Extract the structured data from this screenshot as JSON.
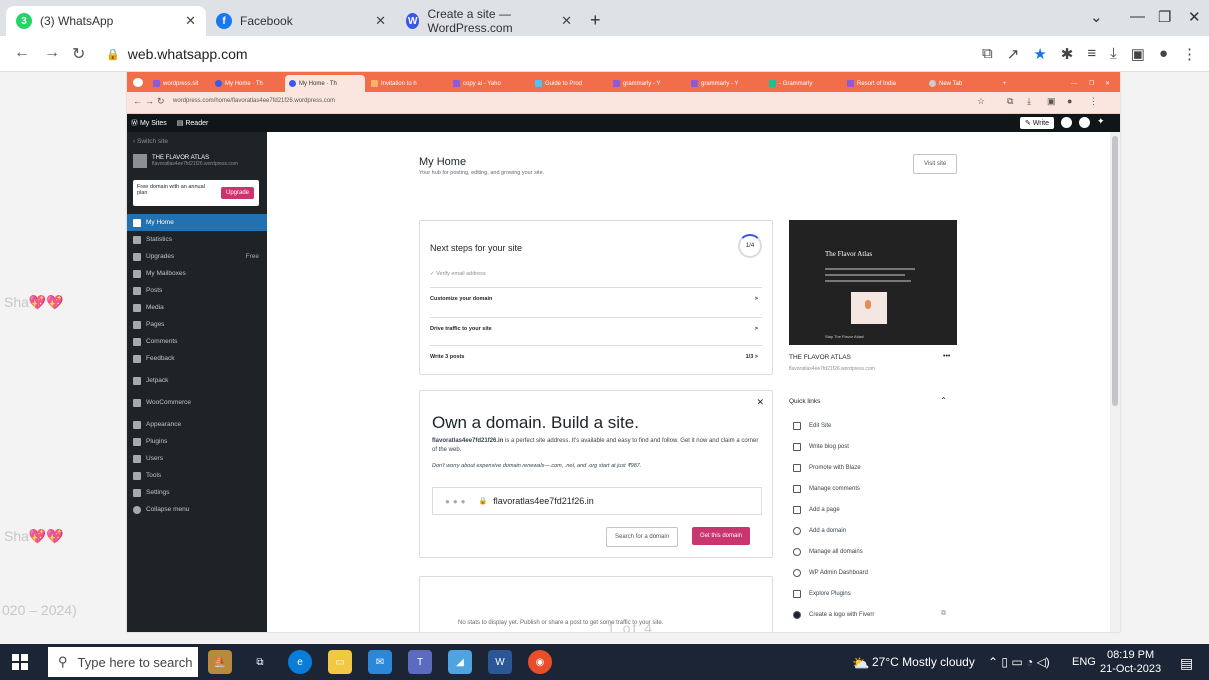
{
  "outer_tabs": [
    {
      "label": "(3) WhatsApp",
      "icon": "whatsapp-icon",
      "badge": "3",
      "color": "#25d366",
      "active": true
    },
    {
      "label": "Facebook",
      "icon": "facebook-icon",
      "color": "#1877f2",
      "active": false
    },
    {
      "label": "Create a site — WordPress.com",
      "icon": "wordpress-icon",
      "color": "#3858e9",
      "active": false
    }
  ],
  "outer_url": "web.whatsapp.com",
  "inner_tabs": [
    "wordpress.sit",
    "My Home · Th",
    "My Home · Th",
    "Invitation to h",
    "copy ai - Yaho",
    "Guide to Prod",
    "grammarly - Y",
    "grammarly - Y",
    "- Grammarly",
    "Resort of India",
    "New Tab"
  ],
  "inner_url": "wordpress.com/home/flavoratlas4ee7fd21f26.wordpress.com",
  "wp": {
    "my_sites": "My Sites",
    "reader": "Reader",
    "write": "Write",
    "switch_site": "Switch site",
    "site_name": "THE FLAVOR ATLAS",
    "site_domain": "flavoratlas4ee7fd21f26.wordpress.com",
    "promo_text": "Free domain with an annual plan",
    "upgrade_btn": "Upgrade",
    "menu": [
      "My Home",
      "Statistics",
      "Upgrades",
      "My Mailboxes",
      "Posts",
      "Media",
      "Pages",
      "Comments",
      "Feedback",
      "Jetpack",
      "WooCommerce",
      "Appearance",
      "Plugins",
      "Users",
      "Tools",
      "Settings",
      "Collapse menu"
    ],
    "free_label": "Free"
  },
  "home": {
    "title": "My Home",
    "subtitle": "Your hub for posting, editing, and growing your site.",
    "visit_site": "Visit site",
    "next_steps": "Next steps for your site",
    "progress": "1/4",
    "verify_email": "Verify email address",
    "steps": [
      {
        "label": "Customize your domain",
        "right": ">"
      },
      {
        "label": "Drive traffic to your site",
        "right": ">"
      },
      {
        "label": "Write 3 posts",
        "right": "1/3  >"
      }
    ],
    "own_title": "Own a domain. Build a site.",
    "own_domain_bold": "flavoratlas4ee7fd21f26.in",
    "own_text": "is a perfect site address. It's available and easy to find and follow. Get it now and claim a corner of the web.",
    "own_note": "Don't worry about expensive domain renewals—.com, .net, and .org start at just ₹987.",
    "domain_value": "flavoratlas4ee7fd21f26.in",
    "search_domain": "Search for a domain",
    "get_domain": "Get this domain",
    "no_stats": "No stats to display yet. Publish or share a post to get some traffic to your site.",
    "pager": "1 of 4"
  },
  "preview": {
    "title": "The Flavor Atlas",
    "caption": "Stay The Flavor Atlas!",
    "site_title": "THE FLAVOR ATLAS",
    "site_domain": "flavoratlas4ee7fd21f26.wordpress.com",
    "more": "•••"
  },
  "quick_links": {
    "title": "Quick links",
    "items": [
      "Edit Site",
      "Write blog post",
      "Promote with Blaze",
      "Manage comments",
      "Add a page",
      "Add a domain",
      "Manage all domains",
      "WP Admin Dashboard",
      "Explore Plugins",
      "Create a logo with Fiverr"
    ]
  },
  "ghost": [
    "Sha💖💖",
    "Sha💖💖",
    "020 – 2024)"
  ],
  "taskbar": {
    "search_placeholder": "Type here to search",
    "weather": "27°C  Mostly cloudy",
    "lang": "ENG",
    "time": "08:19 PM",
    "date": "21-Oct-2023"
  }
}
